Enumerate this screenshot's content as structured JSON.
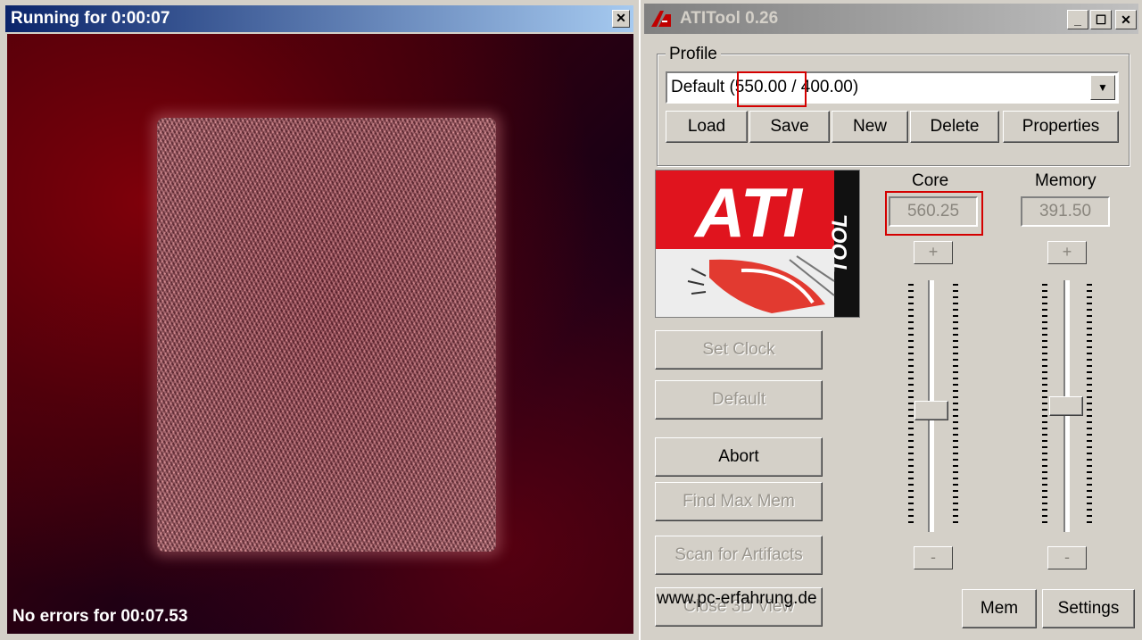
{
  "render_window": {
    "title": "Running for 0:00:07",
    "close_glyph": "✕",
    "status": "No errors for 00:07.53"
  },
  "ati_window": {
    "title": "ATITool 0.26",
    "minimize_glyph": "_",
    "maximize_glyph": "☐",
    "close_glyph": "✕",
    "profile": {
      "group_label": "Profile",
      "selected": "Default (550.00 / 400.00)",
      "buttons": {
        "load": "Load",
        "save": "Save",
        "new": "New",
        "delete": "Delete",
        "properties": "Properties"
      }
    },
    "logo": {
      "main": "ATI",
      "sub": "TOOL"
    },
    "core": {
      "label": "Core",
      "value": "560.25",
      "plus": "+",
      "minus": "-",
      "level": 0.48
    },
    "memory": {
      "label": "Memory",
      "value": "391.50",
      "plus": "+",
      "minus": "-",
      "level": 0.5
    },
    "actions": {
      "set_clock": "Set Clock",
      "default": "Default",
      "abort": "Abort",
      "find_max_mem": "Find Max Mem",
      "scan_artifacts": "Scan for Artifacts",
      "close_3d_view": "Close 3D View"
    },
    "bottom": {
      "mem": "Mem",
      "settings": "Settings"
    }
  },
  "watermark": "www.pc-erfahrung.de",
  "colors": {
    "highlight": "#d40000",
    "ati_red": "#e0141e",
    "titlebar_active": "#0a246a"
  }
}
